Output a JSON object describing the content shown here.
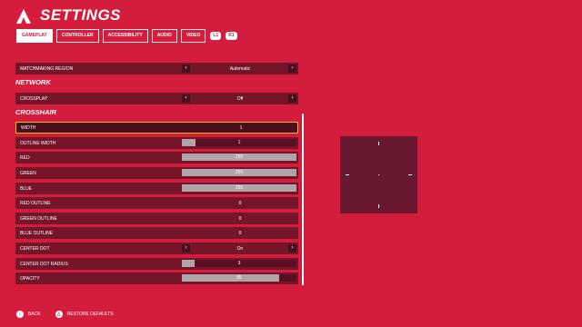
{
  "header": {
    "title": "SETTINGS",
    "logo": "game-logo-icon"
  },
  "tabs": [
    {
      "label": "GAMEPLAY",
      "active": true
    },
    {
      "label": "CONTROLLER"
    },
    {
      "label": "ACCESSIBILITY"
    },
    {
      "label": "AUDIO"
    },
    {
      "label": "VIDEO"
    }
  ],
  "shoulder_buttons": {
    "left": "L1",
    "right": "R1"
  },
  "sections": {
    "network": "NETWORK",
    "crosshair": "CROSSHAIR"
  },
  "rows": {
    "matchmaking": {
      "label": "MATCHMAKING REGION",
      "value": "Automatic"
    },
    "crossplay": {
      "label": "CROSSPLAY",
      "value": "Off"
    },
    "width": {
      "label": "WIDTH",
      "value": "1"
    },
    "outline_width": {
      "label": "OUTLINE WIDTH",
      "value": "1",
      "level": 0.12
    },
    "red": {
      "label": "RED",
      "value": "255",
      "level": 1.0
    },
    "green": {
      "label": "GREEN",
      "value": "255",
      "level": 1.0
    },
    "blue": {
      "label": "BLUE",
      "value": "255",
      "level": 1.0
    },
    "red_outline": {
      "label": "RED OUTLINE",
      "value": "0"
    },
    "green_outline": {
      "label": "GREEN OUTLINE",
      "value": "0"
    },
    "blue_outline": {
      "label": "BLUE OUTLINE",
      "value": "0"
    },
    "center_dot": {
      "label": "CENTER DOT",
      "value": "On"
    },
    "center_dot_radius": {
      "label": "CENTER DOT RADIUS",
      "value": "3",
      "level": 0.11
    },
    "opacity": {
      "label": "OPACITY",
      "value": "85",
      "level": 0.85
    }
  },
  "footer": {
    "back": "BACK",
    "restore": "RESTORE DEFAULTS"
  }
}
